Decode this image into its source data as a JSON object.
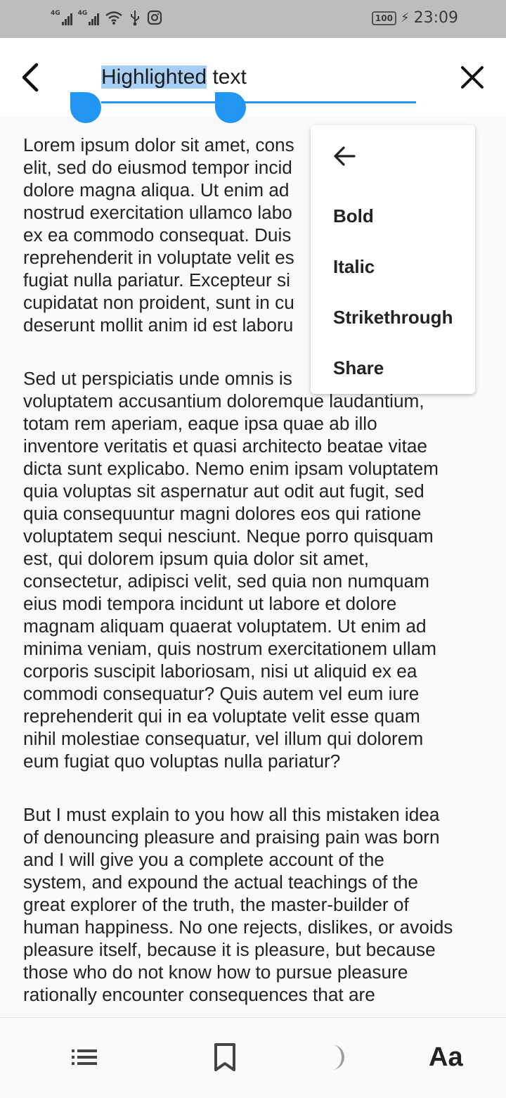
{
  "status_bar": {
    "network_1": "4G",
    "network_2": "4G",
    "battery": "100",
    "time": "23:09",
    "icons": [
      "signal-icon",
      "signal-icon",
      "wifi-icon",
      "usb-icon",
      "instagram-icon",
      "charging-icon"
    ]
  },
  "app_bar": {
    "title_highlighted": "Highlighted",
    "title_rest": " text",
    "back_icon": "back-chevron-icon",
    "close_icon": "close-icon",
    "accent_color": "#2196f3",
    "highlight_color": "#a7cff5"
  },
  "content": {
    "paragraph_1": [
      "Lorem ipsum dolor sit amet, cons",
      "elit, sed do eiusmod tempor incid",
      "dolore magna aliqua. Ut enim ad",
      "nostrud exercitation ullamco labo",
      "ex ea commodo consequat. Duis",
      "reprehenderit in voluptate velit es",
      "fugiat nulla pariatur. Excepteur si",
      "cupidatat non proident, sunt in cu",
      "deserunt mollit anim id est laboru"
    ],
    "paragraph_2": [
      "Sed ut perspiciatis unde omnis is",
      "voluptatem accusantium doloremque laudantium,",
      "totam rem aperiam, eaque ipsa quae ab illo",
      "inventore veritatis et quasi architecto beatae vitae",
      "dicta sunt explicabo. Nemo enim ipsam voluptatem",
      "quia voluptas sit aspernatur aut odit aut fugit, sed",
      "quia consequuntur magni dolores eos qui ratione",
      "voluptatem sequi nesciunt. Neque porro quisquam",
      "est, qui dolorem ipsum quia dolor sit amet,",
      "consectetur, adipisci velit, sed quia non numquam",
      "eius modi tempora incidunt ut labore et dolore",
      "magnam aliquam quaerat voluptatem. Ut enim ad",
      "minima veniam, quis nostrum exercitationem ullam",
      "corporis suscipit laboriosam, nisi ut aliquid ex ea",
      "commodi consequatur? Quis autem vel eum iure",
      "reprehenderit qui in ea voluptate velit esse quam",
      "nihil molestiae consequatur, vel illum qui dolorem",
      "eum fugiat quo voluptas nulla pariatur?"
    ],
    "paragraph_3": [
      "But I must explain to you how all this mistaken idea",
      "of denouncing pleasure and praising pain was born",
      "and I will give you a complete account of the",
      "system, and expound the actual teachings of the",
      "great explorer of the truth, the master-builder of",
      "human happiness. No one rejects, dislikes, or avoids",
      "pleasure itself, because it is pleasure, but because",
      "those who do not know how to pursue pleasure",
      "rationally encounter consequences that are"
    ]
  },
  "context_menu": {
    "back_icon": "arrow-left-icon",
    "items": [
      "Bold",
      "Italic",
      "Strikethrough",
      "Share"
    ]
  },
  "bottom_bar": {
    "toc_icon": "list-icon",
    "bookmark_icon": "bookmark-icon",
    "theme_icon": "moon-icon",
    "font_label": "Aa"
  }
}
